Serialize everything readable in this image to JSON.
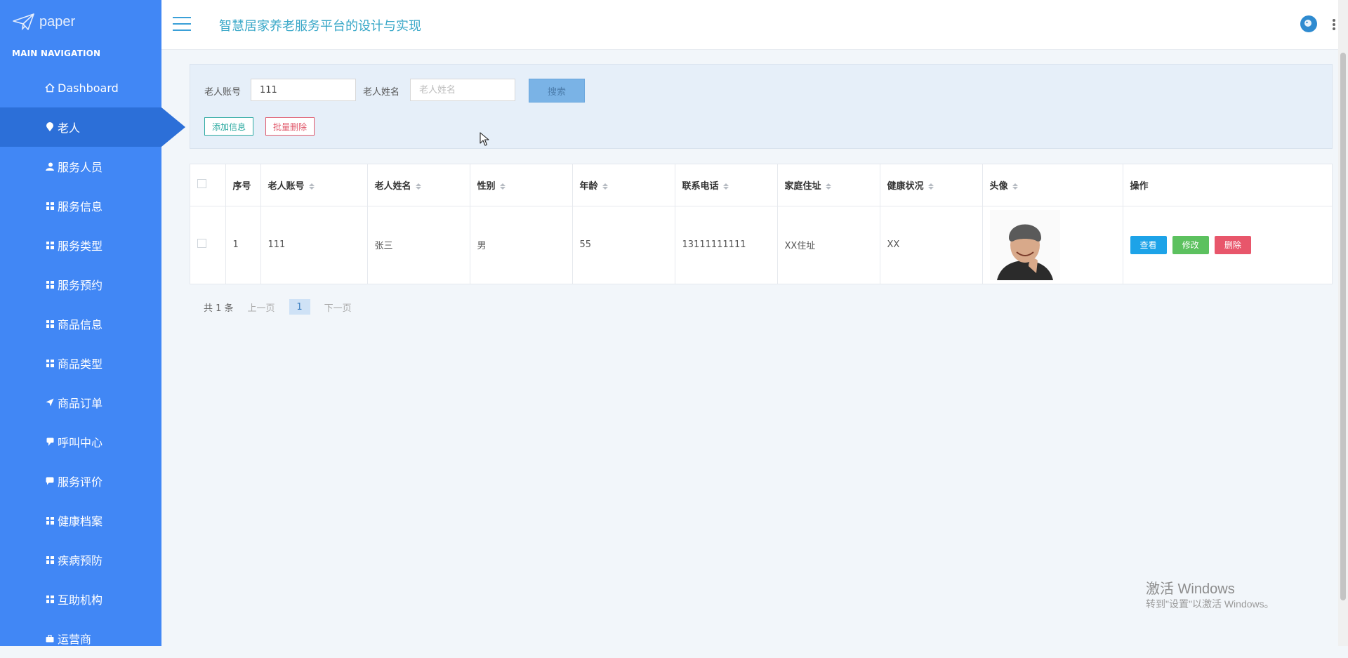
{
  "brand": {
    "name": "paper"
  },
  "nav_header": "MAIN NAVIGATION",
  "nav": [
    {
      "label": "Dashboard",
      "icon": "home-icon"
    },
    {
      "label": "老人",
      "icon": "map-pin-icon",
      "active": true
    },
    {
      "label": "服务人员",
      "icon": "user-icon"
    },
    {
      "label": "服务信息",
      "icon": "grid-icon"
    },
    {
      "label": "服务类型",
      "icon": "grid-icon"
    },
    {
      "label": "服务预约",
      "icon": "grid-icon"
    },
    {
      "label": "商品信息",
      "icon": "grid-icon"
    },
    {
      "label": "商品类型",
      "icon": "grid-icon"
    },
    {
      "label": "商品订单",
      "icon": "send-icon"
    },
    {
      "label": "呼叫中心",
      "icon": "comment-icon"
    },
    {
      "label": "服务评价",
      "icon": "chat-icon"
    },
    {
      "label": "健康档案",
      "icon": "grid-icon"
    },
    {
      "label": "疾病预防",
      "icon": "grid-icon"
    },
    {
      "label": "互助机构",
      "icon": "grid-icon"
    },
    {
      "label": "运营商",
      "icon": "briefcase-icon"
    }
  ],
  "topbar": {
    "title": "智慧居家养老服务平台的设计与实现"
  },
  "search": {
    "account_label": "老人账号",
    "account_value": "111",
    "name_label": "老人姓名",
    "name_placeholder": "老人姓名",
    "search_button": "搜索",
    "add_button": "添加信息",
    "batch_delete_button": "批量删除"
  },
  "table": {
    "headers": [
      "序号",
      "老人账号",
      "老人姓名",
      "性别",
      "年龄",
      "联系电话",
      "家庭住址",
      "健康状况",
      "头像",
      "操作"
    ],
    "rows": [
      {
        "index": "1",
        "account": "111",
        "name": "张三",
        "gender": "男",
        "age": "55",
        "phone": "13111111111",
        "address": "XX住址",
        "health": "XX"
      }
    ],
    "actions": {
      "view": "查看",
      "edit": "修改",
      "delete": "删除"
    }
  },
  "pagination": {
    "total": "共 1 条",
    "prev": "上一页",
    "current": "1",
    "next": "下一页"
  },
  "watermark": {
    "title": "激活 Windows",
    "subtitle": "转到\"设置\"以激活 Windows。"
  },
  "colors": {
    "sidebar": "#4187f5",
    "sidebar_active": "#2c6fd8",
    "accent": "#3aa8c8"
  }
}
